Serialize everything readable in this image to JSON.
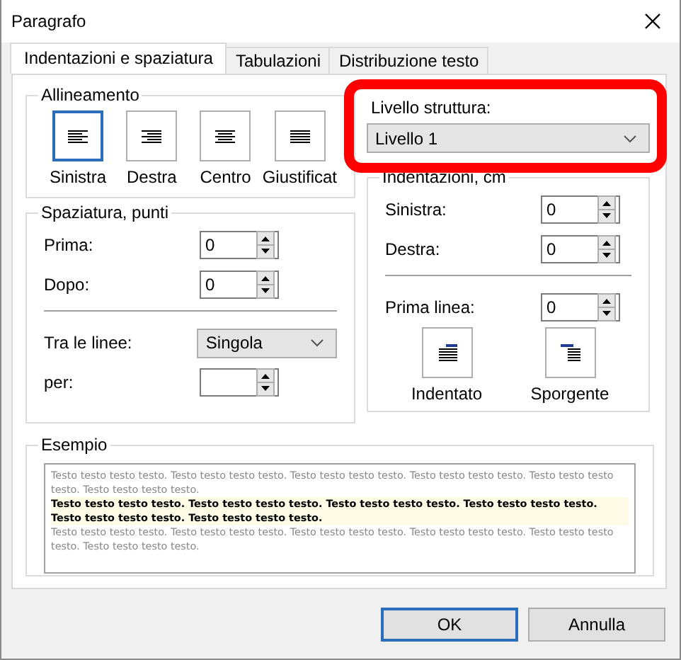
{
  "window": {
    "title": "Paragrafo"
  },
  "tabs": [
    {
      "label": "Indentazioni e spaziatura",
      "selected": true
    },
    {
      "label": "Tabulazioni",
      "selected": false
    },
    {
      "label": "Distribuzione testo",
      "selected": false
    }
  ],
  "alignment": {
    "title": "Allineamento",
    "options": [
      {
        "label": "Sinistra",
        "kind": "left",
        "selected": true
      },
      {
        "label": "Destra",
        "kind": "right",
        "selected": false
      },
      {
        "label": "Centro",
        "kind": "center",
        "selected": false
      },
      {
        "label": "Giustificat",
        "kind": "justify",
        "selected": false
      }
    ]
  },
  "spacing": {
    "title": "Spaziatura, punti",
    "before": {
      "label": "Prima:",
      "value": "0"
    },
    "after": {
      "label": "Dopo:",
      "value": "0"
    },
    "line": {
      "label": "Tra le linee:",
      "value": "Singola"
    },
    "by": {
      "label": "per:"
    }
  },
  "outline": {
    "label": "Livello struttura:",
    "value": "Livello 1"
  },
  "indent": {
    "title": "Indentazioni, cm",
    "left": {
      "label": "Sinistra:",
      "value": "0"
    },
    "right": {
      "label": "Destra:",
      "value": "0"
    },
    "first_line": {
      "label": "Prima linea:",
      "value": "0"
    },
    "types": [
      {
        "label": "Indentato",
        "kind": "first-line"
      },
      {
        "label": "Sporgente",
        "kind": "hanging"
      }
    ]
  },
  "preview": {
    "title": "Esempio",
    "paragraphs": [
      {
        "kind": "previous",
        "text": "Testo testo testo testo. Testo testo testo testo. Testo testo testo testo. Testo testo testo testo. Testo testo testo testo. Testo testo testo testo."
      },
      {
        "kind": "current",
        "text": "Testo testo testo testo. Testo testo testo testo. Testo testo testo testo. Testo testo testo testo. Testo testo testo testo. Testo testo testo testo."
      },
      {
        "kind": "next",
        "text": "Testo testo testo testo. Testo testo testo testo. Testo testo testo testo. Testo testo testo testo. Testo testo testo testo. Testo testo testo testo."
      }
    ]
  },
  "buttons": [
    {
      "label": "OK",
      "default": true
    },
    {
      "label": "Annulla",
      "default": false
    }
  ],
  "annotation": {
    "kind": "frame"
  }
}
